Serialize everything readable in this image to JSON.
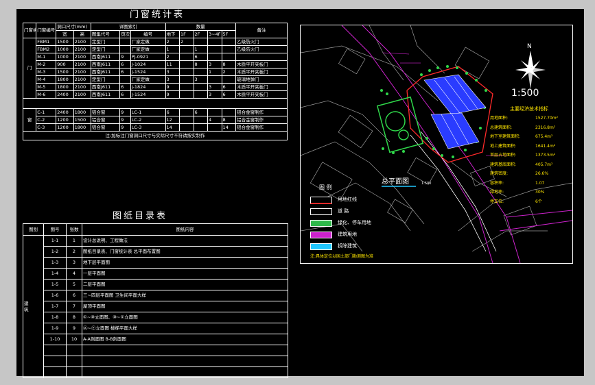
{
  "door_table": {
    "title": "门窗统计表",
    "head": {
      "type": "门窗类型",
      "no": "门窗编号",
      "size": "洞口尺寸(mm)",
      "w": "宽",
      "h": "高",
      "std": "详图索引",
      "code": "图集代号",
      "page": "页次",
      "id": "编号",
      "qty": "数量",
      "floors": [
        "地下",
        "1F",
        "2F",
        "3~4F",
        "5F"
      ],
      "remark": "备注"
    },
    "door_group": "门",
    "doors": [
      {
        "no": "FBM1",
        "w": "1500",
        "h": "2100",
        "code": "定型门",
        "page": "",
        "id": "厂家定做",
        "q": [
          "2",
          "2",
          "",
          "",
          ""
        ],
        "remark": "乙级防火门"
      },
      {
        "no": "FBM2",
        "w": "1000",
        "h": "2100",
        "code": "定型门",
        "page": "",
        "id": "厂家定做",
        "q": [
          "1",
          "",
          "1",
          "",
          ""
        ],
        "remark": "乙级防火门"
      },
      {
        "no": "M-1",
        "w": "1000",
        "h": "2100",
        "code": "西南J611",
        "page": "9",
        "id": "PJ-0921",
        "q": [
          "2",
          "",
          "6",
          "",
          ""
        ],
        "remark": ""
      },
      {
        "no": "M-2",
        "w": "900",
        "h": "2100",
        "code": "西南J611",
        "page": "6",
        "id": "J-1024",
        "q": [
          "11",
          "",
          "8",
          "3",
          "8"
        ],
        "remark": "木质平开夹板门"
      },
      {
        "no": "M-3",
        "w": "1500",
        "h": "2100",
        "code": "西南J611",
        "page": "6",
        "id": "J-1524",
        "q": [
          "3",
          "",
          "",
          "1",
          "2"
        ],
        "remark": "木质平开夹板门"
      },
      {
        "no": "M-4",
        "w": "1800",
        "h": "2100",
        "code": "定型门",
        "page": "",
        "id": "厂家定做",
        "q": [
          "3",
          "",
          "3",
          "",
          ""
        ],
        "remark": "玻璃地弹门"
      },
      {
        "no": "M-5",
        "w": "1800",
        "h": "2100",
        "code": "西南J611",
        "page": "6",
        "id": "J-1824",
        "q": [
          "9",
          "",
          "",
          "3",
          "6"
        ],
        "remark": "木质平开夹板门"
      },
      {
        "no": "M-6",
        "w": "2400",
        "h": "2100",
        "code": "西南J611",
        "page": "6",
        "id": "J-1524",
        "q": [
          "9",
          "",
          "",
          "3",
          "6"
        ],
        "remark": "木质平开夹板门"
      }
    ],
    "window_group": "窗",
    "windows": [
      {
        "no": "C-1",
        "w": "2400",
        "h": "1800",
        "code": "铝合窗",
        "page": "9",
        "id": "LC-1",
        "q": [
          "6",
          "",
          "6",
          "",
          ""
        ],
        "remark": "铝合金窗制作"
      },
      {
        "no": "C-2",
        "w": "1200",
        "h": "1500",
        "code": "铝合窗",
        "page": "9",
        "id": "LC-2",
        "q": [
          "12",
          "",
          "",
          "4",
          "8"
        ],
        "remark": "铝合金窗制作"
      },
      {
        "no": "C-3",
        "w": "1200",
        "h": "1800",
        "code": "铝合窗",
        "page": "9",
        "id": "LC-3",
        "q": [
          "14",
          "",
          "",
          "",
          "14"
        ],
        "remark": "铝合金窗制作"
      }
    ],
    "note": "注:加标注门窗洞口尺寸与实际尺寸不符请按实制作"
  },
  "drawing_index": {
    "title": "图纸目录表",
    "head": {
      "cat": "图别",
      "no": "图号",
      "page": "张数",
      "content": "图纸内容"
    },
    "category": "建筑",
    "rows": [
      {
        "no": "1-1",
        "page": "1",
        "content": "设计总说明、工程做法"
      },
      {
        "no": "1-2",
        "page": "2",
        "content": "图纸目录表、门窗统计表 总平面布置图"
      },
      {
        "no": "1-3",
        "page": "3",
        "content": "地下层平面图"
      },
      {
        "no": "1-4",
        "page": "4",
        "content": "一层平面图"
      },
      {
        "no": "1-5",
        "page": "5",
        "content": "二层平面图"
      },
      {
        "no": "1-6",
        "page": "6",
        "content": "三~四层平面图 卫生间平面大样"
      },
      {
        "no": "1-7",
        "page": "7",
        "content": "屋顶平面图"
      },
      {
        "no": "1-8",
        "page": "8",
        "content": "①~⑩立面图、⑩~①立面图"
      },
      {
        "no": "1-9",
        "page": "9",
        "content": "Ⓐ~Ⓔ立面图 楼梯平面大样"
      },
      {
        "no": "1-10",
        "page": "10",
        "content": "A-A剖面图 B-B剖面图"
      }
    ]
  },
  "site_plan": {
    "north": "N",
    "scale": "1:500",
    "title": "总平面图",
    "title_scale": "1:500",
    "stats_title": "主要经济技术指标",
    "stats": [
      {
        "label": "用地面积:",
        "value": "1527.70m²"
      },
      {
        "label": "总建筑面积:",
        "value": "2316.8m²"
      },
      {
        "label": "地下室建筑面积:",
        "value": "675.4m²"
      },
      {
        "label": "地上建筑面积:",
        "value": "1641.4m²"
      },
      {
        "label": "首层占地面积:",
        "value": "1373.5m²"
      },
      {
        "label": "建筑基底面积:",
        "value": "405.7m²"
      },
      {
        "label": "建筑密度:",
        "value": "26.6%"
      },
      {
        "label": "容积率:",
        "value": "1.07"
      },
      {
        "label": "绿地率:",
        "value": "30%"
      },
      {
        "label": "停车位:",
        "value": "6个"
      }
    ],
    "legend_title": "图 例",
    "legend": [
      {
        "label": "用地红线",
        "color": "#ff2a2a"
      },
      {
        "label": "道 路",
        "color": "#ffffff"
      },
      {
        "label": "绿化、停车用地",
        "color": "#2fb84a"
      },
      {
        "label": "建筑用地",
        "color": "#cc22cc"
      },
      {
        "label": "拆除建筑",
        "color": "#22c8ff"
      }
    ],
    "note": "注:具体定位以国土部门勘测图为准"
  }
}
